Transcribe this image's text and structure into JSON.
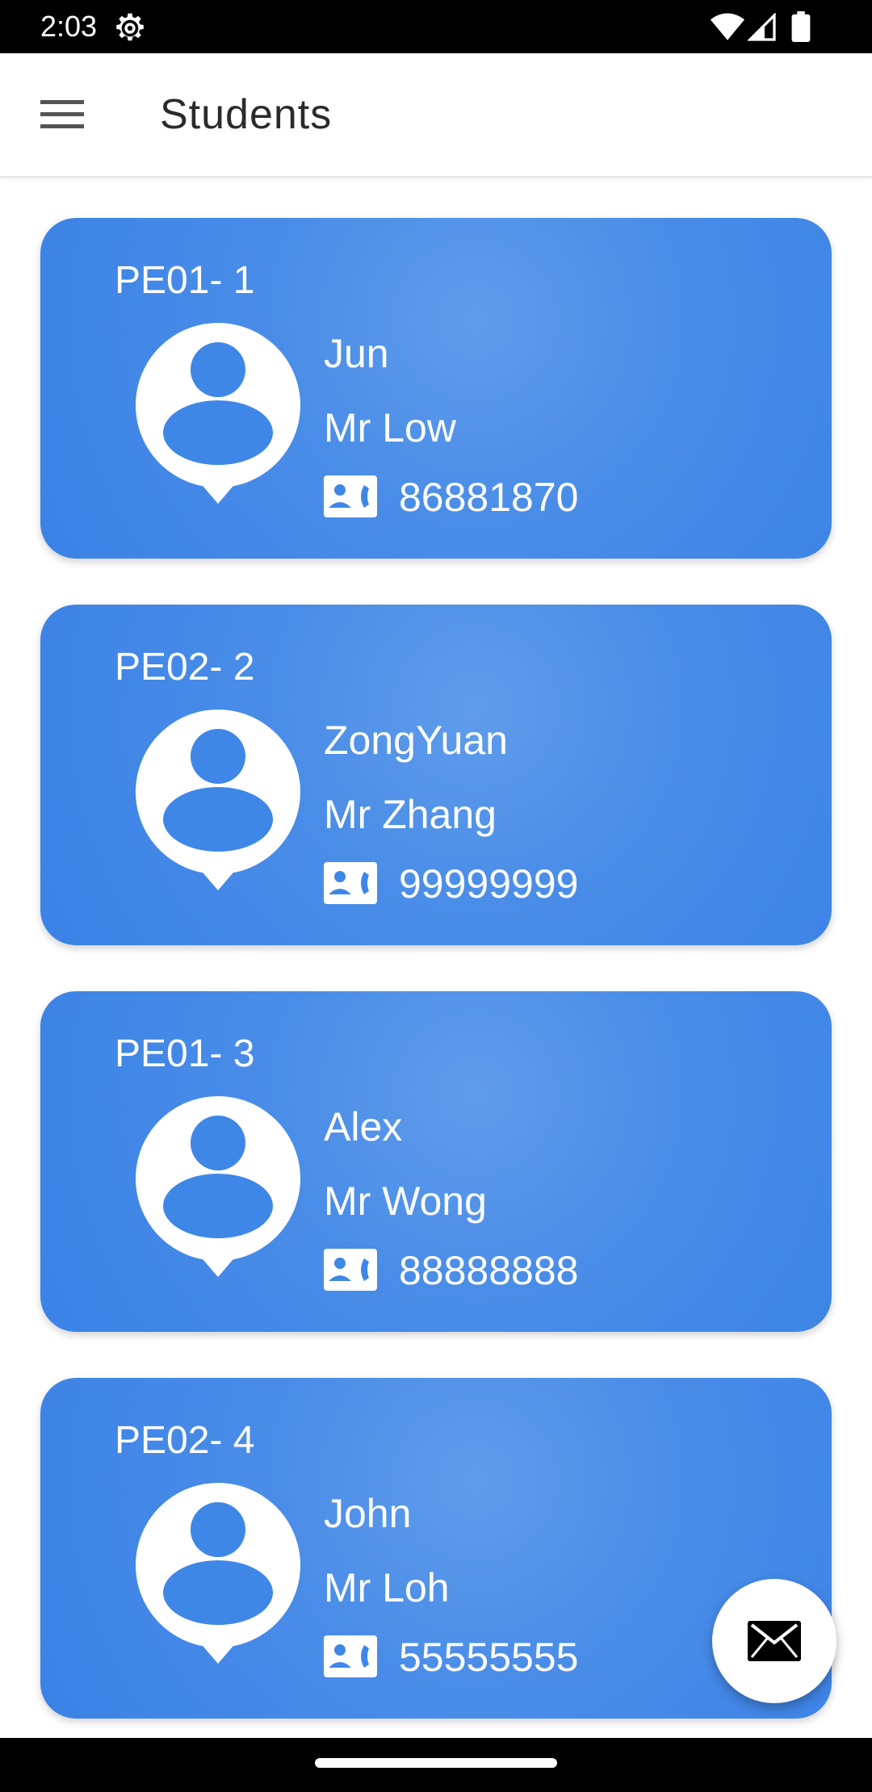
{
  "status_bar": {
    "time": "2:03",
    "icons": [
      "gear-icon",
      "wifi-icon",
      "signal-icon",
      "battery-icon"
    ]
  },
  "app_bar": {
    "title": "Students",
    "menu_icon": "menu-icon"
  },
  "students": [
    {
      "code": "PE01- 1",
      "name": "Jun",
      "teacher": "Mr Low",
      "phone": "86881870"
    },
    {
      "code": "PE02- 2",
      "name": "ZongYuan",
      "teacher": "Mr Zhang",
      "phone": "99999999"
    },
    {
      "code": "PE01- 3",
      "name": "Alex",
      "teacher": "Mr Wong",
      "phone": "88888888"
    },
    {
      "code": "PE02- 4",
      "name": "John",
      "teacher": "Mr Loh",
      "phone": "55555555"
    }
  ],
  "fab": {
    "icon": "mail-icon"
  },
  "colors": {
    "card_accent": "#3a82e6",
    "card_highlight": "#5f9cea",
    "text_on_card": "#ffffff",
    "app_bar_text": "#2b2b2b"
  }
}
